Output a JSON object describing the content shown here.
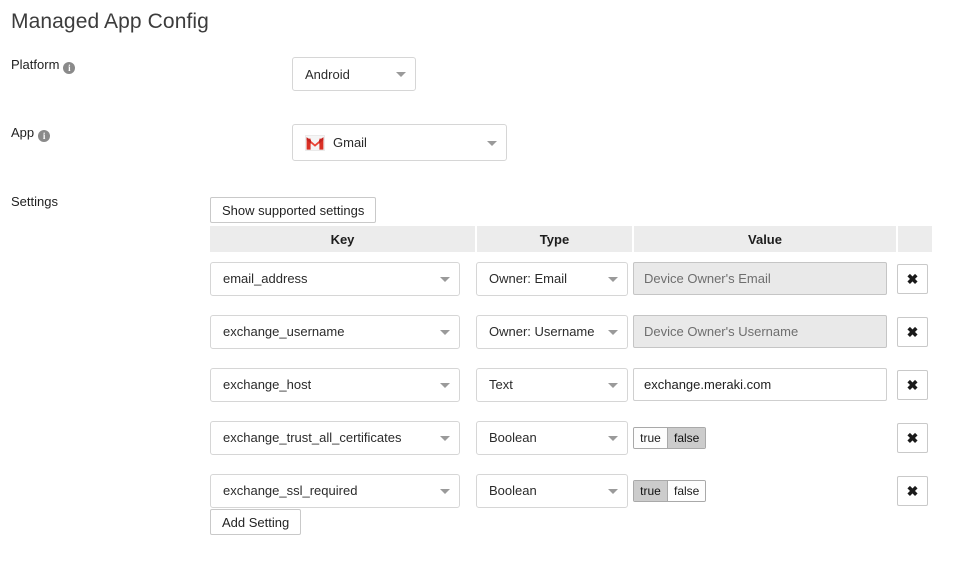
{
  "page_title": "Managed App Config",
  "fields": {
    "platform": {
      "label": "Platform",
      "info_icon": "info-icon",
      "value": "Android"
    },
    "app": {
      "label": "App",
      "info_icon": "info-icon",
      "icon": "gmail-icon",
      "value": "Gmail"
    },
    "settings": {
      "label": "Settings"
    }
  },
  "buttons": {
    "show_supported": "Show supported settings",
    "add_setting": "Add Setting",
    "delete_icon": "✖"
  },
  "table": {
    "headers": {
      "key": "Key",
      "type": "Type",
      "value": "Value",
      "actions": ""
    },
    "rows": [
      {
        "key": "email_address",
        "type": "Owner: Email",
        "value_kind": "text",
        "value": "Device Owner's Email",
        "disabled": true
      },
      {
        "key": "exchange_username",
        "type": "Owner: Username",
        "value_kind": "text",
        "value": "Device Owner's Username",
        "disabled": true
      },
      {
        "key": "exchange_host",
        "type": "Text",
        "value_kind": "text",
        "value": "exchange.meraki.com",
        "disabled": false
      },
      {
        "key": "exchange_trust_all_certificates",
        "type": "Boolean",
        "value_kind": "boolean",
        "options": [
          "true",
          "false"
        ],
        "selected": "false"
      },
      {
        "key": "exchange_ssl_required",
        "type": "Boolean",
        "value_kind": "boolean",
        "options": [
          "true",
          "false"
        ],
        "selected": "true"
      }
    ]
  },
  "colors": {
    "header_bg": "#ececec",
    "disabled_bg": "#e9e9e9",
    "gmail_red": "#d93025",
    "selected_toggle": "#cccccc",
    "text": "#222222"
  }
}
